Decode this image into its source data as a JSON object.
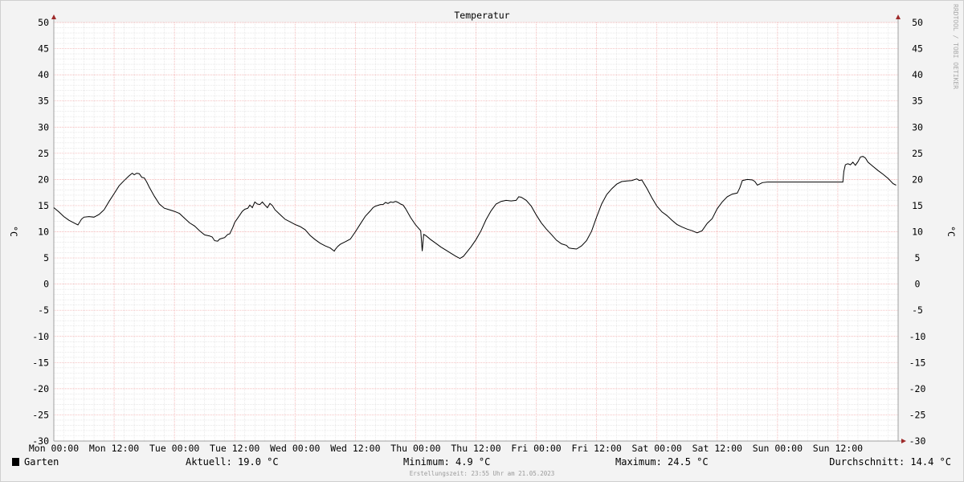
{
  "chart_data": {
    "type": "line",
    "title": "Temperatur",
    "ylabel_left": "°C",
    "ylabel_right": "°C",
    "ylim": [
      -30,
      50
    ],
    "yticks": [
      50,
      45,
      40,
      35,
      30,
      25,
      20,
      15,
      10,
      5,
      0,
      -5,
      -10,
      -15,
      -20,
      -25,
      -30
    ],
    "xlim": [
      0,
      168
    ],
    "xticks": [
      {
        "x": 0,
        "label": "Mon 00:00"
      },
      {
        "x": 12,
        "label": "Mon 12:00"
      },
      {
        "x": 24,
        "label": "Tue 00:00"
      },
      {
        "x": 36,
        "label": "Tue 12:00"
      },
      {
        "x": 48,
        "label": "Wed 00:00"
      },
      {
        "x": 60,
        "label": "Wed 12:00"
      },
      {
        "x": 72,
        "label": "Thu 00:00"
      },
      {
        "x": 84,
        "label": "Thu 12:00"
      },
      {
        "x": 96,
        "label": "Fri 00:00"
      },
      {
        "x": 108,
        "label": "Fri 12:00"
      },
      {
        "x": 120,
        "label": "Sat 00:00"
      },
      {
        "x": 132,
        "label": "Sat 12:00"
      },
      {
        "x": 144,
        "label": "Sun 00:00"
      },
      {
        "x": 156,
        "label": "Sun 12:00"
      }
    ],
    "grid": true,
    "legend_position": "bottom-left",
    "series": [
      {
        "name": "Garten",
        "color": "#000000",
        "points": [
          [
            0,
            14.6
          ],
          [
            1,
            13.8
          ],
          [
            2,
            12.9
          ],
          [
            3,
            12.2
          ],
          [
            4,
            11.7
          ],
          [
            4.8,
            11.3
          ],
          [
            5.5,
            12.4
          ],
          [
            6,
            12.8
          ],
          [
            7,
            12.9
          ],
          [
            8,
            12.8
          ],
          [
            9,
            13.3
          ],
          [
            10,
            14.2
          ],
          [
            11,
            15.8
          ],
          [
            12,
            17.3
          ],
          [
            13,
            18.8
          ],
          [
            14,
            19.8
          ],
          [
            15,
            20.7
          ],
          [
            15.6,
            21.2
          ],
          [
            16,
            20.9
          ],
          [
            16.5,
            21.2
          ],
          [
            17,
            21.1
          ],
          [
            17.5,
            20.4
          ],
          [
            18,
            20.3
          ],
          [
            18.5,
            19.5
          ],
          [
            19,
            18.5
          ],
          [
            20,
            16.8
          ],
          [
            21,
            15.3
          ],
          [
            22,
            14.5
          ],
          [
            23,
            14.2
          ],
          [
            24,
            13.9
          ],
          [
            25,
            13.5
          ],
          [
            26,
            12.6
          ],
          [
            27,
            11.7
          ],
          [
            28,
            11.1
          ],
          [
            29,
            10.2
          ],
          [
            30,
            9.4
          ],
          [
            31,
            9.2
          ],
          [
            31.5,
            9.0
          ],
          [
            32,
            8.3
          ],
          [
            32.6,
            8.2
          ],
          [
            33,
            8.6
          ],
          [
            34,
            8.9
          ],
          [
            34.6,
            9.5
          ],
          [
            35,
            9.6
          ],
          [
            35.6,
            10.8
          ],
          [
            36,
            11.8
          ],
          [
            37,
            13.2
          ],
          [
            37.5,
            13.9
          ],
          [
            38,
            14.3
          ],
          [
            38.6,
            14.5
          ],
          [
            39,
            15.1
          ],
          [
            39.5,
            14.6
          ],
          [
            40,
            15.7
          ],
          [
            40.5,
            15.3
          ],
          [
            41,
            15.2
          ],
          [
            41.5,
            15.7
          ],
          [
            42,
            15.1
          ],
          [
            42.5,
            14.6
          ],
          [
            43,
            15.4
          ],
          [
            43.5,
            15.0
          ],
          [
            44,
            14.2
          ],
          [
            45,
            13.3
          ],
          [
            46,
            12.4
          ],
          [
            47,
            11.9
          ],
          [
            48,
            11.4
          ],
          [
            49,
            11.0
          ],
          [
            50,
            10.4
          ],
          [
            51,
            9.3
          ],
          [
            52,
            8.5
          ],
          [
            53,
            7.8
          ],
          [
            54,
            7.3
          ],
          [
            55,
            6.9
          ],
          [
            55.8,
            6.3
          ],
          [
            56,
            6.6
          ],
          [
            56.5,
            7.2
          ],
          [
            57,
            7.6
          ],
          [
            58,
            8.1
          ],
          [
            59,
            8.6
          ],
          [
            60,
            10.0
          ],
          [
            61,
            11.5
          ],
          [
            62,
            13.0
          ],
          [
            63,
            14.0
          ],
          [
            63.5,
            14.6
          ],
          [
            64,
            14.9
          ],
          [
            65,
            15.2
          ],
          [
            65.5,
            15.2
          ],
          [
            66,
            15.6
          ],
          [
            66.5,
            15.4
          ],
          [
            67,
            15.7
          ],
          [
            67.5,
            15.6
          ],
          [
            68,
            15.8
          ],
          [
            68.5,
            15.6
          ],
          [
            69,
            15.3
          ],
          [
            69.5,
            15.1
          ],
          [
            70,
            14.4
          ],
          [
            71,
            12.7
          ],
          [
            72,
            11.3
          ],
          [
            73,
            10.2
          ],
          [
            73.3,
            6.3
          ],
          [
            73.6,
            9.5
          ],
          [
            74,
            9.3
          ],
          [
            75,
            8.5
          ],
          [
            76,
            7.8
          ],
          [
            77,
            7.1
          ],
          [
            78,
            6.5
          ],
          [
            79,
            5.9
          ],
          [
            80,
            5.3
          ],
          [
            80.8,
            4.9
          ],
          [
            81.5,
            5.3
          ],
          [
            82,
            5.9
          ],
          [
            83,
            7.1
          ],
          [
            84,
            8.5
          ],
          [
            85,
            10.2
          ],
          [
            86,
            12.3
          ],
          [
            87,
            14.0
          ],
          [
            88,
            15.3
          ],
          [
            89,
            15.8
          ],
          [
            90,
            16.0
          ],
          [
            91,
            15.9
          ],
          [
            92,
            16.0
          ],
          [
            92.5,
            16.7
          ],
          [
            93,
            16.6
          ],
          [
            94,
            16.0
          ],
          [
            95,
            14.9
          ],
          [
            96,
            13.2
          ],
          [
            97,
            11.7
          ],
          [
            98,
            10.5
          ],
          [
            99,
            9.5
          ],
          [
            100,
            8.4
          ],
          [
            101,
            7.7
          ],
          [
            102,
            7.4
          ],
          [
            102.5,
            6.9
          ],
          [
            103,
            6.8
          ],
          [
            104,
            6.7
          ],
          [
            105,
            7.3
          ],
          [
            106,
            8.3
          ],
          [
            107,
            10.1
          ],
          [
            108,
            12.8
          ],
          [
            109,
            15.3
          ],
          [
            110,
            17.1
          ],
          [
            111,
            18.2
          ],
          [
            112,
            19.1
          ],
          [
            113,
            19.6
          ],
          [
            114,
            19.7
          ],
          [
            115,
            19.8
          ],
          [
            116,
            20.1
          ],
          [
            116.5,
            19.8
          ],
          [
            117,
            19.9
          ],
          [
            118,
            18.3
          ],
          [
            119,
            16.5
          ],
          [
            120,
            14.9
          ],
          [
            121,
            13.8
          ],
          [
            122,
            13.1
          ],
          [
            123,
            12.2
          ],
          [
            124,
            11.4
          ],
          [
            125,
            10.9
          ],
          [
            126,
            10.5
          ],
          [
            127,
            10.2
          ],
          [
            128,
            9.8
          ],
          [
            129,
            10.2
          ],
          [
            130,
            11.6
          ],
          [
            131,
            12.5
          ],
          [
            132,
            14.4
          ],
          [
            133,
            15.7
          ],
          [
            134,
            16.7
          ],
          [
            135,
            17.2
          ],
          [
            136,
            17.4
          ],
          [
            136.5,
            18.4
          ],
          [
            137,
            19.8
          ],
          [
            138,
            20.0
          ],
          [
            139,
            19.9
          ],
          [
            139.5,
            19.6
          ],
          [
            140,
            18.9
          ],
          [
            141,
            19.4
          ],
          [
            142,
            19.5
          ],
          [
            143,
            19.5
          ],
          [
            150,
            19.5
          ],
          [
            157,
            19.5
          ],
          [
            157.2,
            21.5
          ],
          [
            157.5,
            22.8
          ],
          [
            158,
            23.0
          ],
          [
            158.5,
            22.8
          ],
          [
            159,
            23.3
          ],
          [
            159.5,
            22.7
          ],
          [
            160,
            23.4
          ],
          [
            160.5,
            24.3
          ],
          [
            161,
            24.4
          ],
          [
            161.5,
            24.1
          ],
          [
            162,
            23.3
          ],
          [
            163,
            22.5
          ],
          [
            164,
            21.7
          ],
          [
            165,
            21.0
          ],
          [
            166,
            20.2
          ],
          [
            167,
            19.2
          ],
          [
            167.6,
            18.9
          ]
        ]
      }
    ]
  },
  "legend": {
    "label": "Garten",
    "swatch_color": "#000000"
  },
  "stats": {
    "current": "Aktuell: 19.0 °C",
    "minimum": "Minimum: 4.9 °C",
    "maximum": "Maximum: 24.5 °C",
    "average": "Durchschnitt: 14.4 °C"
  },
  "footer": {
    "created": "Erstellungszeit: 23:55 Uhr am 21.05.2023"
  },
  "watermark": "RRDTOOL / TOBI OETIKER"
}
